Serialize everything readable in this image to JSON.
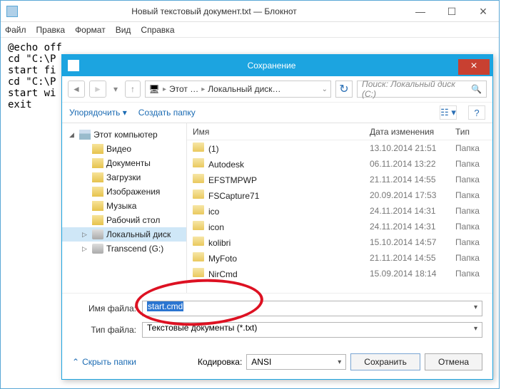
{
  "notepad": {
    "title": "Новый текстовый документ.txt — Блокнот",
    "menu": [
      "Файл",
      "Правка",
      "Формат",
      "Вид",
      "Справка"
    ],
    "content": "@echo off\ncd \"C:\\P\nstart fi\ncd \"C:\\P\nstart wi\nexit"
  },
  "dialog": {
    "title": "Сохранение",
    "breadcrumb": {
      "seg1": "Этот …",
      "seg2": "Локальный диск…"
    },
    "search_placeholder": "Поиск: Локальный диск (C:)",
    "toolbar": {
      "organize": "Упорядочить",
      "newfolder": "Создать папку"
    },
    "tree": [
      {
        "label": "Этот компьютер",
        "type": "pc",
        "level": 0,
        "exp": "◢"
      },
      {
        "label": "Видео",
        "type": "f",
        "level": 1
      },
      {
        "label": "Документы",
        "type": "f",
        "level": 1
      },
      {
        "label": "Загрузки",
        "type": "f",
        "level": 1
      },
      {
        "label": "Изображения",
        "type": "f",
        "level": 1
      },
      {
        "label": "Музыка",
        "type": "f",
        "level": 1
      },
      {
        "label": "Рабочий стол",
        "type": "f",
        "level": 1
      },
      {
        "label": "Локальный диск",
        "type": "d",
        "level": 1,
        "exp": "▷",
        "sel": true
      },
      {
        "label": "Transcend (G:)",
        "type": "d",
        "level": 1,
        "exp": "▷"
      }
    ],
    "columns": {
      "name": "Имя",
      "date": "Дата изменения",
      "type": "Тип"
    },
    "files": [
      {
        "name": "(1)",
        "date": "13.10.2014 21:51",
        "type": "Папка"
      },
      {
        "name": "Autodesk",
        "date": "06.11.2014 13:22",
        "type": "Папка"
      },
      {
        "name": "EFSTMPWP",
        "date": "21.11.2014 14:55",
        "type": "Папка"
      },
      {
        "name": "FSCapture71",
        "date": "20.09.2014 17:53",
        "type": "Папка"
      },
      {
        "name": "ico",
        "date": "24.11.2014 14:31",
        "type": "Папка"
      },
      {
        "name": "icon",
        "date": "24.11.2014 14:31",
        "type": "Папка"
      },
      {
        "name": "kolibri",
        "date": "15.10.2014 14:57",
        "type": "Папка"
      },
      {
        "name": "MyFoto",
        "date": "21.11.2014 14:55",
        "type": "Папка"
      },
      {
        "name": "NirCmd",
        "date": "15.09.2014 18:14",
        "type": "Папка"
      }
    ],
    "filename_label": "Имя файла:",
    "filetype_label": "Тип файла:",
    "filename_value": "start.cmd",
    "filetype_value": "Текстовые документы (*.txt)",
    "encoding_label": "Кодировка:",
    "encoding_value": "ANSI",
    "hide_folders": "Скрыть папки",
    "save": "Сохранить",
    "cancel": "Отмена"
  }
}
